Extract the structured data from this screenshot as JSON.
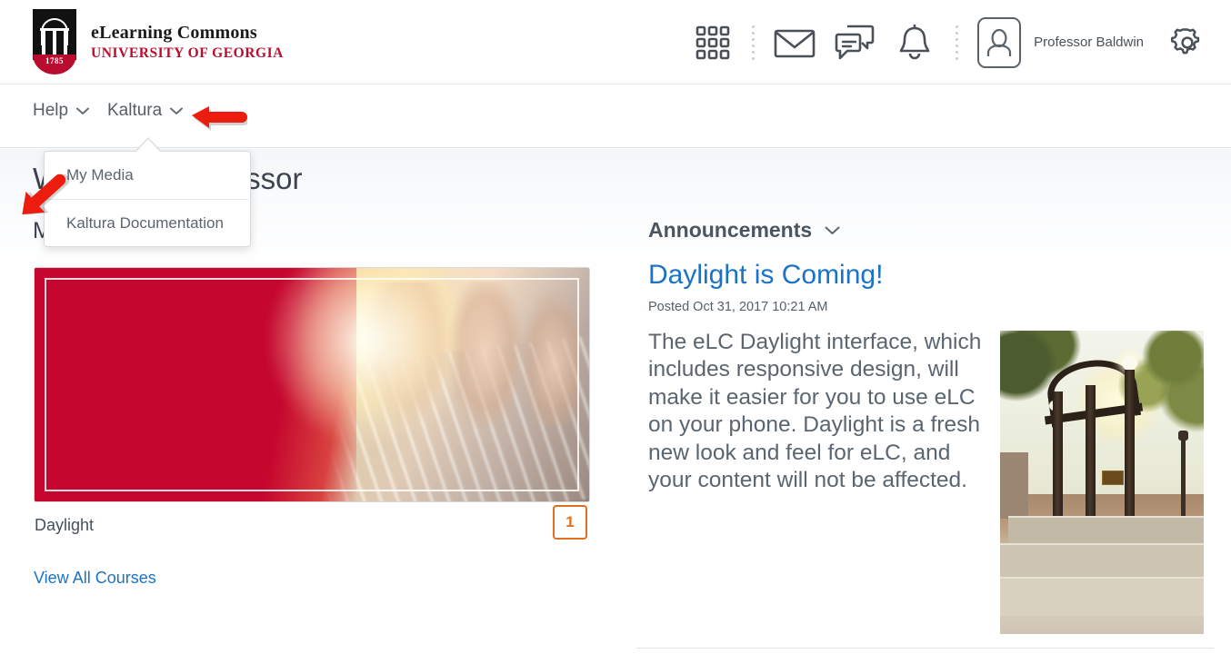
{
  "header": {
    "brand_line1": "eLearning Commons",
    "brand_line2": "UNIVERSITY OF GEORGIA",
    "logo_year": "1785",
    "icons": {
      "grid": "grid-apps-icon",
      "mail": "envelope-icon",
      "chat": "chat-bubbles-icon",
      "bell": "notifications-bell-icon",
      "avatar": "user-avatar-icon",
      "gear": "settings-gear-icon"
    },
    "user_name": "Professor Baldwin"
  },
  "nav": {
    "items": [
      {
        "label": "Help"
      },
      {
        "label": "Kaltura"
      }
    ]
  },
  "dropdown": {
    "open_for": "Kaltura",
    "items": [
      {
        "label": "My Media"
      },
      {
        "label": "Kaltura Documentation"
      }
    ]
  },
  "main": {
    "page_title": "Welcome, Professor",
    "section_title": "My Courses",
    "course": {
      "name": "Daylight",
      "badge_count": "1"
    },
    "view_all_label": "View All Courses"
  },
  "announcements": {
    "heading": "Announcements",
    "title": "Daylight is Coming!",
    "posted": "Posted Oct 31, 2017 10:21 AM",
    "body": "The eLC Daylight interface, which includes responsive design, will make it easier for you to use eLC on your phone. Daylight is a fresh new look and feel for eLC, and your content will not be affected.",
    "close_icon": "close-x-icon",
    "photo_alt": "uga-arch-photo"
  },
  "annotations": [
    {
      "name": "arrow-pointing-left-at-kaltura",
      "direction": "left",
      "color": "#ec1c0e"
    },
    {
      "name": "arrow-pointing-at-my-media",
      "direction": "up-right",
      "color": "#ec1c0e"
    }
  ],
  "colors": {
    "brand_red": "#ba0c2f",
    "link_blue": "#1b72c7",
    "badge_orange": "#e06f1f",
    "arrow_red": "#ec1c0e",
    "text_gray": "#5a6570"
  }
}
